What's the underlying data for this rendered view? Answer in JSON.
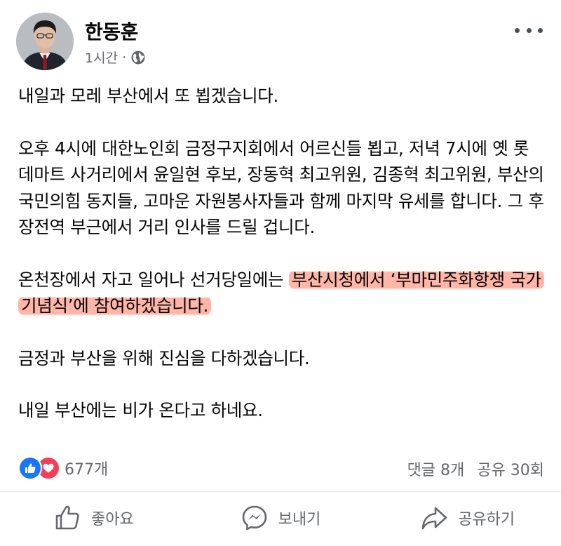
{
  "post": {
    "author": "한동훈",
    "time": "1시간",
    "separator": "·",
    "privacy_icon": "globe-icon",
    "more_icon": "more-icon",
    "paragraphs": [
      {
        "segments": [
          {
            "text": "내일과 모레 부산에서 또 뵙겠습니다."
          }
        ]
      },
      {
        "segments": [
          {
            "text": "오후 4시에 대한노인회 금정구지회에서 어르신들 뵙고, 저녁 7시에 옛 롯데마트 사거리에서 윤일현 후보, 장동혁 최고위원, 김종혁 최고위원, 부산의 국민의힘 동지들, 고마운 자원봉사자들과 함께 마지막 유세를 합니다. 그 후 장전역 부근에서 거리 인사를 드릴 겁니다."
          }
        ]
      },
      {
        "segments": [
          {
            "text": "온천장에서 자고 일어나 선거당일에는 "
          },
          {
            "text": "부산시청에서 ‘부마민주화항쟁 국가기념식’에 참여하겠습니다.",
            "highlight": true
          }
        ]
      },
      {
        "segments": [
          {
            "text": "금정과 부산을 위해 진심을 다하겠습니다."
          }
        ]
      },
      {
        "segments": [
          {
            "text": "내일 부산에는 비가 온다고 하네요."
          }
        ]
      }
    ],
    "highlight_color": "#ff785f"
  },
  "stats": {
    "reactions_count": "677개",
    "reaction_icons": [
      "like-icon",
      "love-icon"
    ],
    "comments": "댓글 8개",
    "shares": "공유 30회"
  },
  "actions": {
    "like_label": "좋아요",
    "send_label": "보내기",
    "share_label": "공유하기"
  },
  "colors": {
    "like_blue": "#1877f2",
    "love_red": "#f33e58",
    "secondary_text": "#65676b"
  }
}
